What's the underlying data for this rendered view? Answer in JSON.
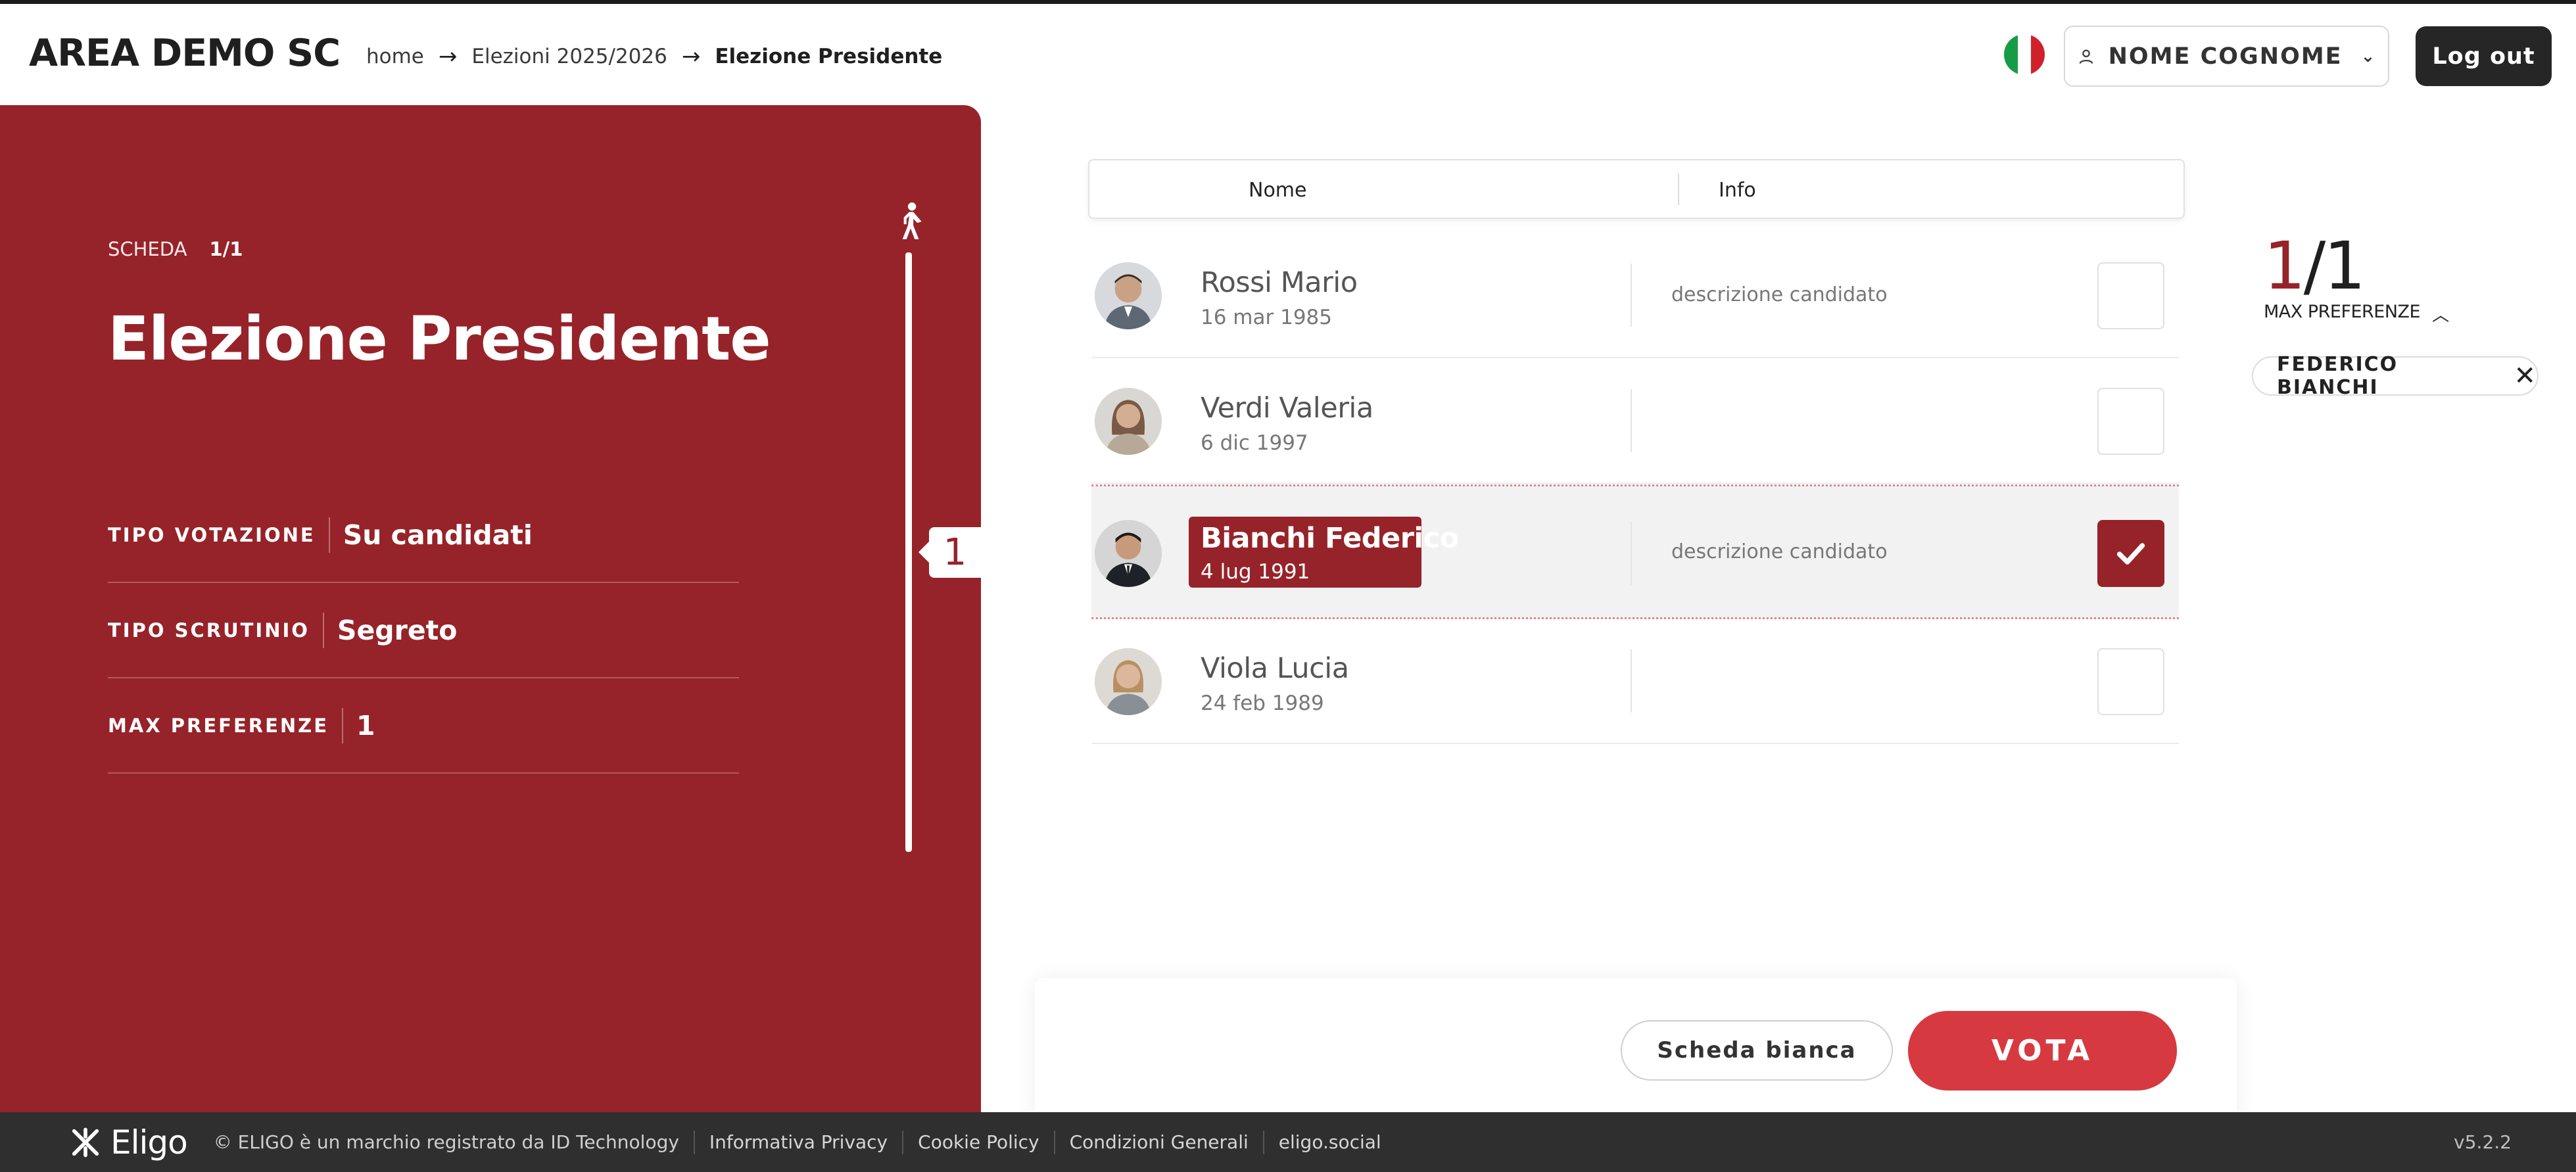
{
  "header": {
    "brand": "AREA DEMO SC",
    "breadcrumb": [
      "home",
      "Elezioni 2025/2026",
      "Elezione Presidente"
    ],
    "user_label": "NOME COGNOME",
    "logout_label": "Log out",
    "flag_colors": [
      "#169b46",
      "#ffffff",
      "#d0212b"
    ]
  },
  "panel": {
    "scheda_label": "SCHEDA",
    "scheda_value": "1/1",
    "title": "Elezione Presidente",
    "rows": [
      {
        "key": "TIPO VOTAZIONE",
        "value": "Su candidati"
      },
      {
        "key": "TIPO SCRUTINIO",
        "value": "Segreto"
      },
      {
        "key": "MAX PREFERENZE",
        "value": "1"
      }
    ],
    "step": "1",
    "accent": "#962329"
  },
  "table": {
    "col_nome": "Nome",
    "col_info": "Info",
    "candidates": [
      {
        "name": "Rossi Mario",
        "date": "16 mar 1985",
        "info": "descrizione candidato",
        "selected": false
      },
      {
        "name": "Verdi Valeria",
        "date": "6 dic 1997",
        "info": "",
        "selected": false
      },
      {
        "name": "Bianchi Federico",
        "date": "4 lug 1991",
        "info": "descrizione candidato",
        "selected": true
      },
      {
        "name": "Viola Lucia",
        "date": "24 feb 1989",
        "info": "",
        "selected": false
      }
    ]
  },
  "preferences": {
    "current": "1",
    "total": "/1",
    "label": "MAX PREFERENZE",
    "chip": "FEDERICO BIANCHI"
  },
  "actions": {
    "blank_label": "Scheda bianca",
    "vote_label": "VOTA",
    "vote_color": "#d63a40"
  },
  "footer": {
    "logo_text": "Eligo",
    "copyright": "© ELIGO è un marchio registrato da ID Technology",
    "links": [
      "Informativa Privacy",
      "Cookie Policy",
      "Condizioni Generali",
      "eligo.social"
    ],
    "version": "v5.2.2"
  }
}
